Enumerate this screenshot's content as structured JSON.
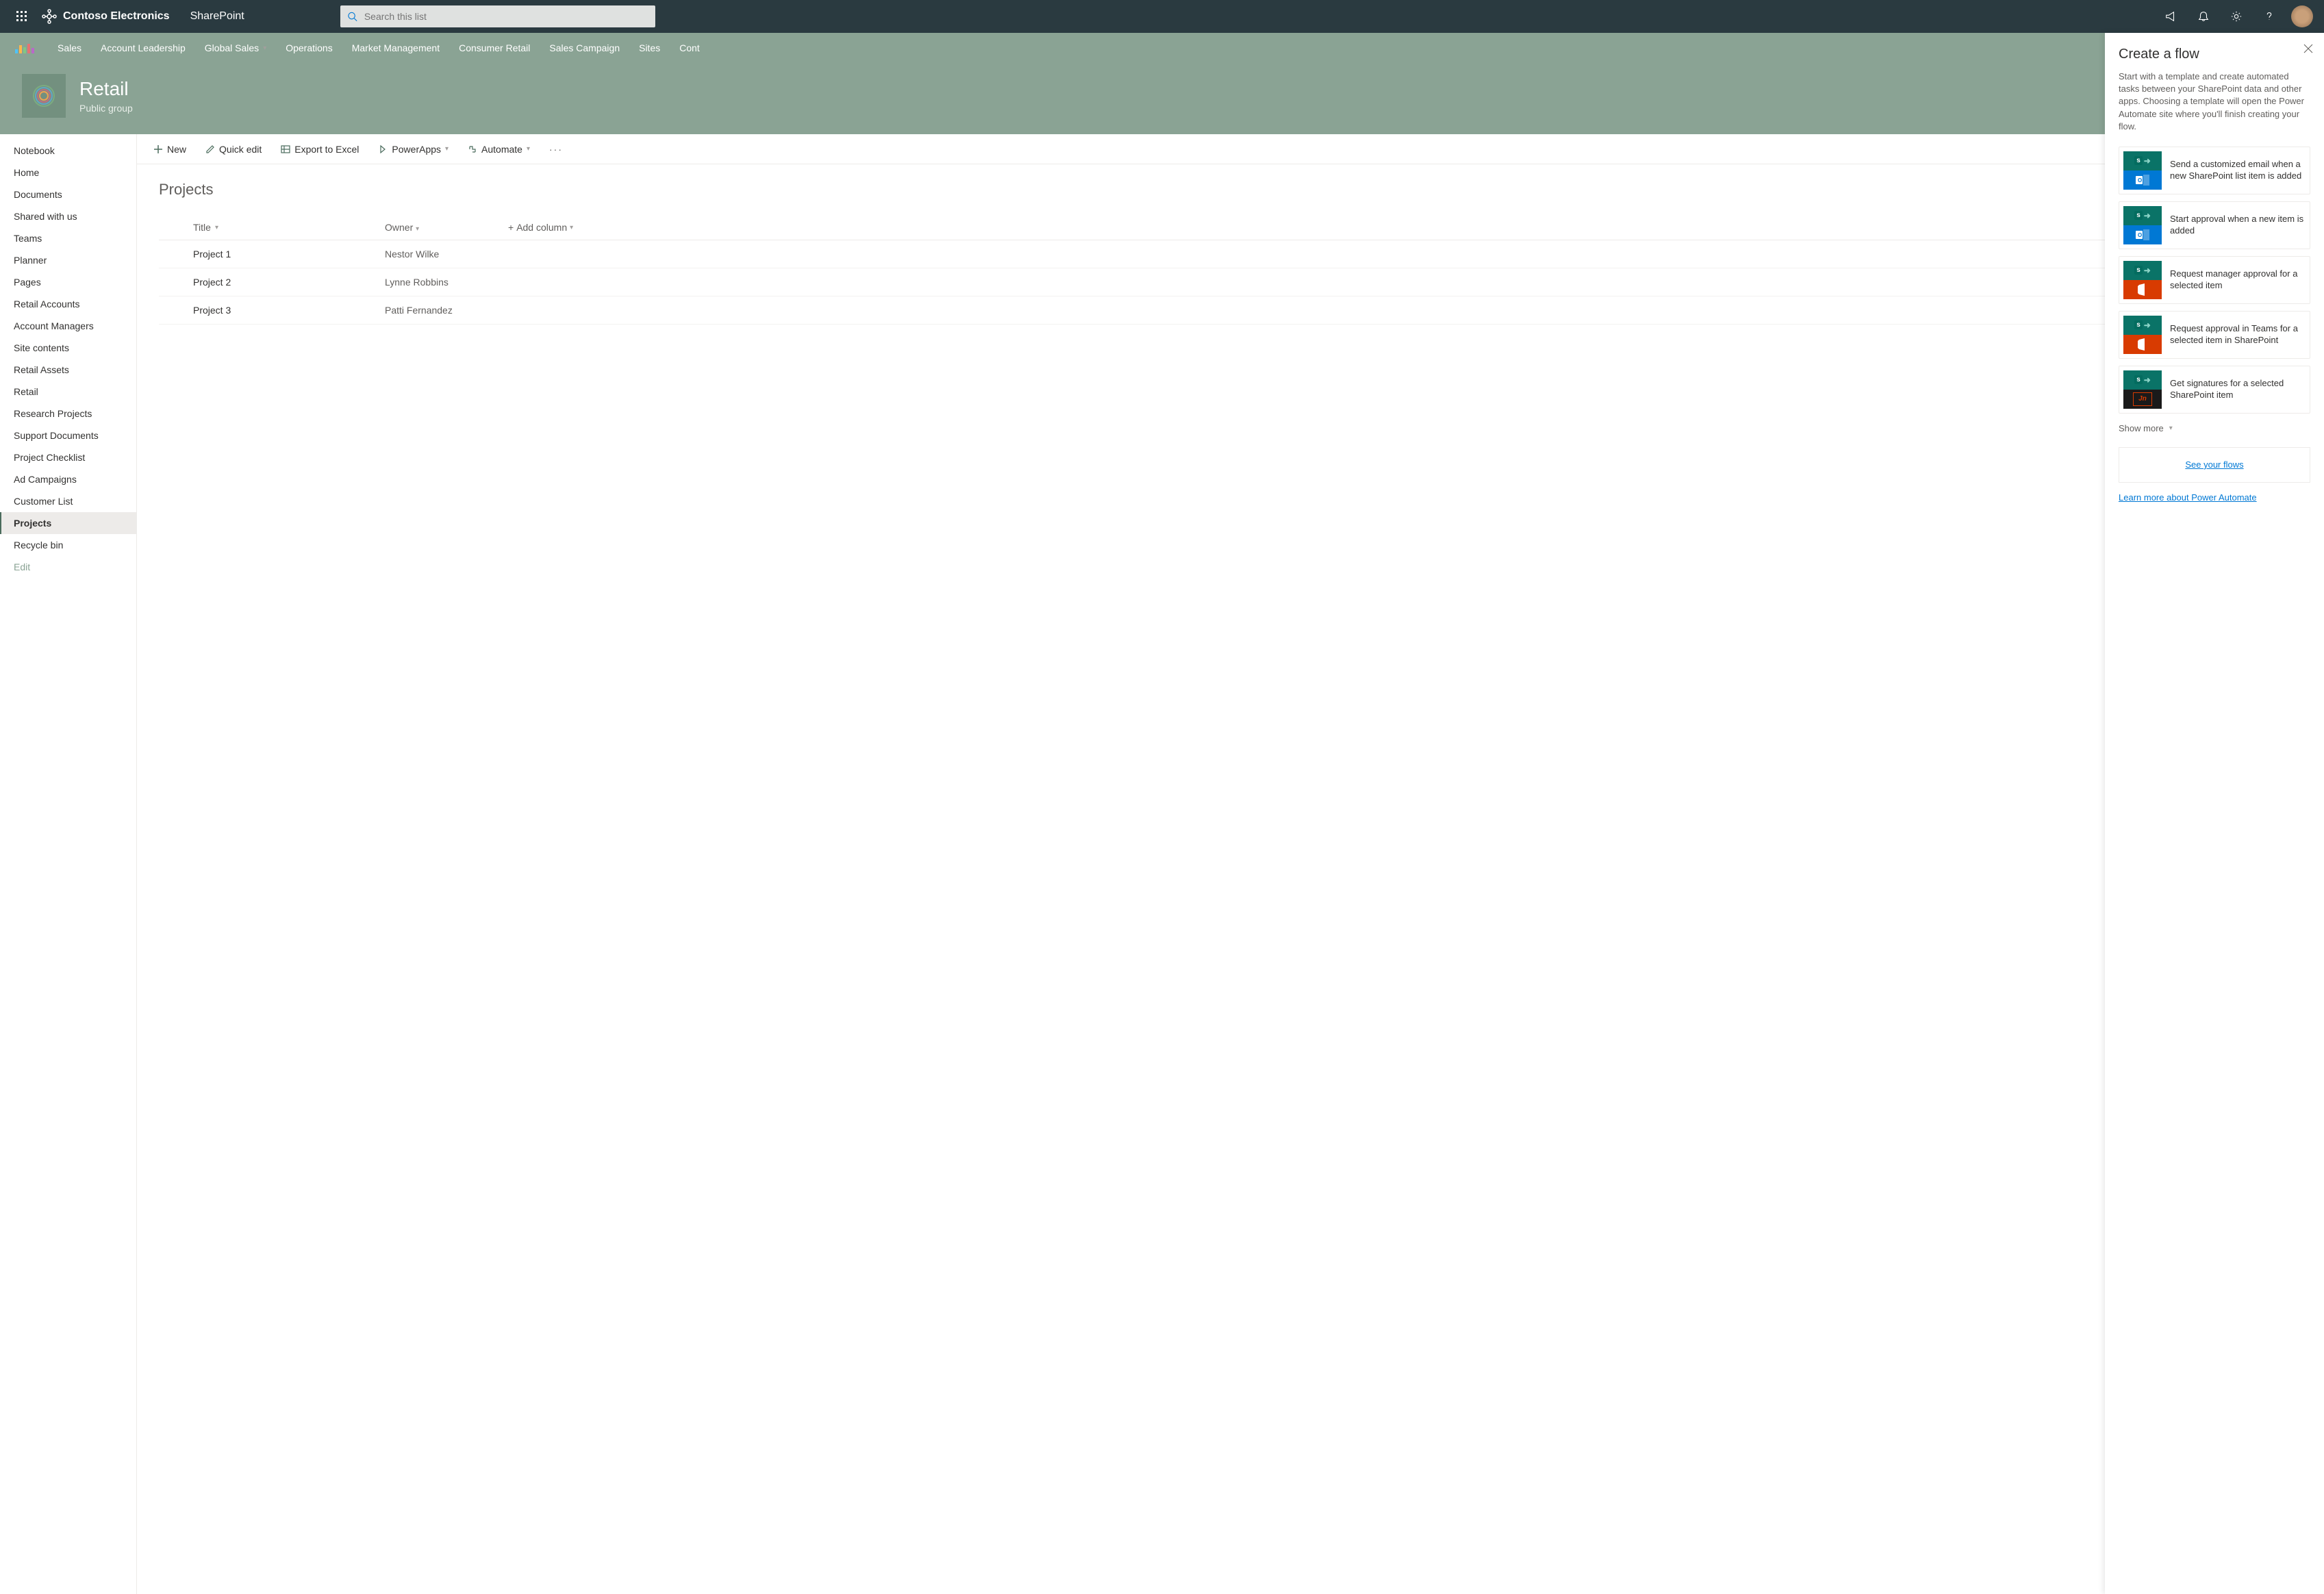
{
  "header": {
    "brand": "Contoso Electronics",
    "app": "SharePoint",
    "search_placeholder": "Search this list"
  },
  "site_nav": [
    "Sales",
    "Account Leadership",
    "Global Sales",
    "Operations",
    "Market Management",
    "Consumer Retail",
    "Sales Campaign",
    "Sites",
    "Cont"
  ],
  "site": {
    "title": "Retail",
    "subtitle": "Public group"
  },
  "left_nav": [
    {
      "label": "Notebook",
      "active": false
    },
    {
      "label": "Home",
      "active": false
    },
    {
      "label": "Documents",
      "active": false
    },
    {
      "label": "Shared with us",
      "active": false
    },
    {
      "label": "Teams",
      "active": false
    },
    {
      "label": "Planner",
      "active": false
    },
    {
      "label": "Pages",
      "active": false
    },
    {
      "label": "Retail Accounts",
      "active": false
    },
    {
      "label": "Account Managers",
      "active": false
    },
    {
      "label": "Site contents",
      "active": false
    },
    {
      "label": "Retail Assets",
      "active": false
    },
    {
      "label": "Retail",
      "active": false
    },
    {
      "label": "Research Projects",
      "active": false
    },
    {
      "label": "Support Documents",
      "active": false
    },
    {
      "label": "Project Checklist",
      "active": false
    },
    {
      "label": "Ad Campaigns",
      "active": false
    },
    {
      "label": "Customer List",
      "active": false
    },
    {
      "label": "Projects",
      "active": true
    },
    {
      "label": "Recycle bin",
      "active": false
    }
  ],
  "left_nav_edit": "Edit",
  "commands": {
    "new": "New",
    "quick_edit": "Quick edit",
    "export": "Export to Excel",
    "powerapps": "PowerApps",
    "automate": "Automate"
  },
  "list": {
    "title": "Projects",
    "columns": {
      "title": "Title",
      "owner": "Owner",
      "add": "Add column"
    },
    "rows": [
      {
        "title": "Project 1",
        "owner": "Nestor Wilke"
      },
      {
        "title": "Project 2",
        "owner": "Lynne Robbins"
      },
      {
        "title": "Project 3",
        "owner": "Patti Fernandez"
      }
    ]
  },
  "panel": {
    "title": "Create a flow",
    "desc": "Start with a template and create automated tasks between your SharePoint data and other apps. Choosing a template will open the Power Automate site where you'll finish creating your flow.",
    "templates": [
      {
        "text": "Send a customized email when a new SharePoint list item is added",
        "top": "sp",
        "bot": "outlook"
      },
      {
        "text": "Start approval when a new item is added",
        "top": "sp",
        "bot": "outlook"
      },
      {
        "text": "Request manager approval for a selected item",
        "top": "sp",
        "bot": "office"
      },
      {
        "text": "Request approval in Teams for a selected item in SharePoint",
        "top": "sp",
        "bot": "office"
      },
      {
        "text": "Get signatures for a selected SharePoint item",
        "top": "sp",
        "bot": "sign"
      }
    ],
    "show_more": "Show more",
    "see_flows": "See your flows",
    "learn_more": "Learn more about Power Automate"
  }
}
